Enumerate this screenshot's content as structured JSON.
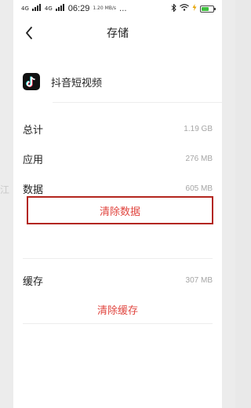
{
  "status_bar": {
    "network": "4G",
    "time": "06:29",
    "speed": "1.20\nMB/s",
    "dots": "..."
  },
  "backdrop": {
    "fragment": "江"
  },
  "header": {
    "title": "存储"
  },
  "app": {
    "name": "抖音短视频"
  },
  "storage": {
    "total": {
      "label": "总计",
      "value": "1.19 GB"
    },
    "app": {
      "label": "应用",
      "value": "276 MB"
    },
    "data": {
      "label": "数据",
      "value": "605 MB"
    },
    "cache": {
      "label": "缓存",
      "value": "307 MB"
    }
  },
  "actions": {
    "clear_data": "清除数据",
    "clear_cache": "清除缓存"
  },
  "colors": {
    "accent_red": "#e0453f",
    "highlight_border": "#b3261e"
  }
}
